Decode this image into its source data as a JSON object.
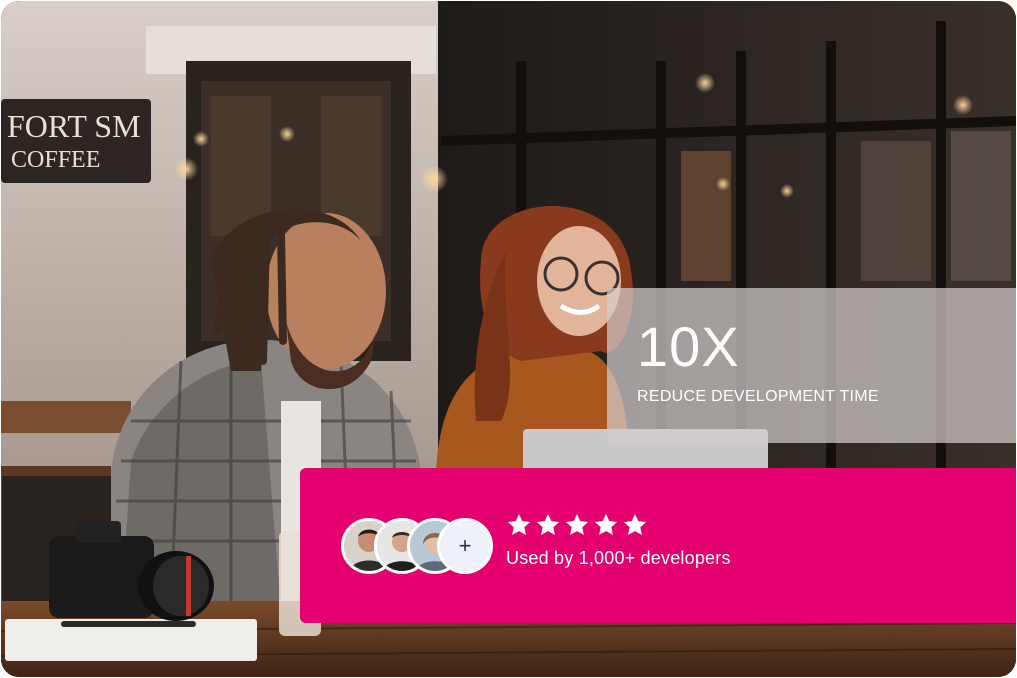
{
  "stat": {
    "value": "10X",
    "label": "REDUCE DEVELOPMENT TIME"
  },
  "social_proof": {
    "avatars": [
      "avatar-person-1",
      "avatar-person-2",
      "avatar-person-3"
    ],
    "more_label": "+",
    "rating": 5,
    "rating_max": 5,
    "text": "Used by 1,000+ developers"
  },
  "background_sign": {
    "line1": "FORT SM",
    "line2": "COFFEE"
  },
  "colors": {
    "accent": "#e5006f",
    "card_overlay": "#d2cdcd",
    "text": "#ffffff"
  },
  "icons": [
    "star-icon",
    "plus-icon"
  ]
}
